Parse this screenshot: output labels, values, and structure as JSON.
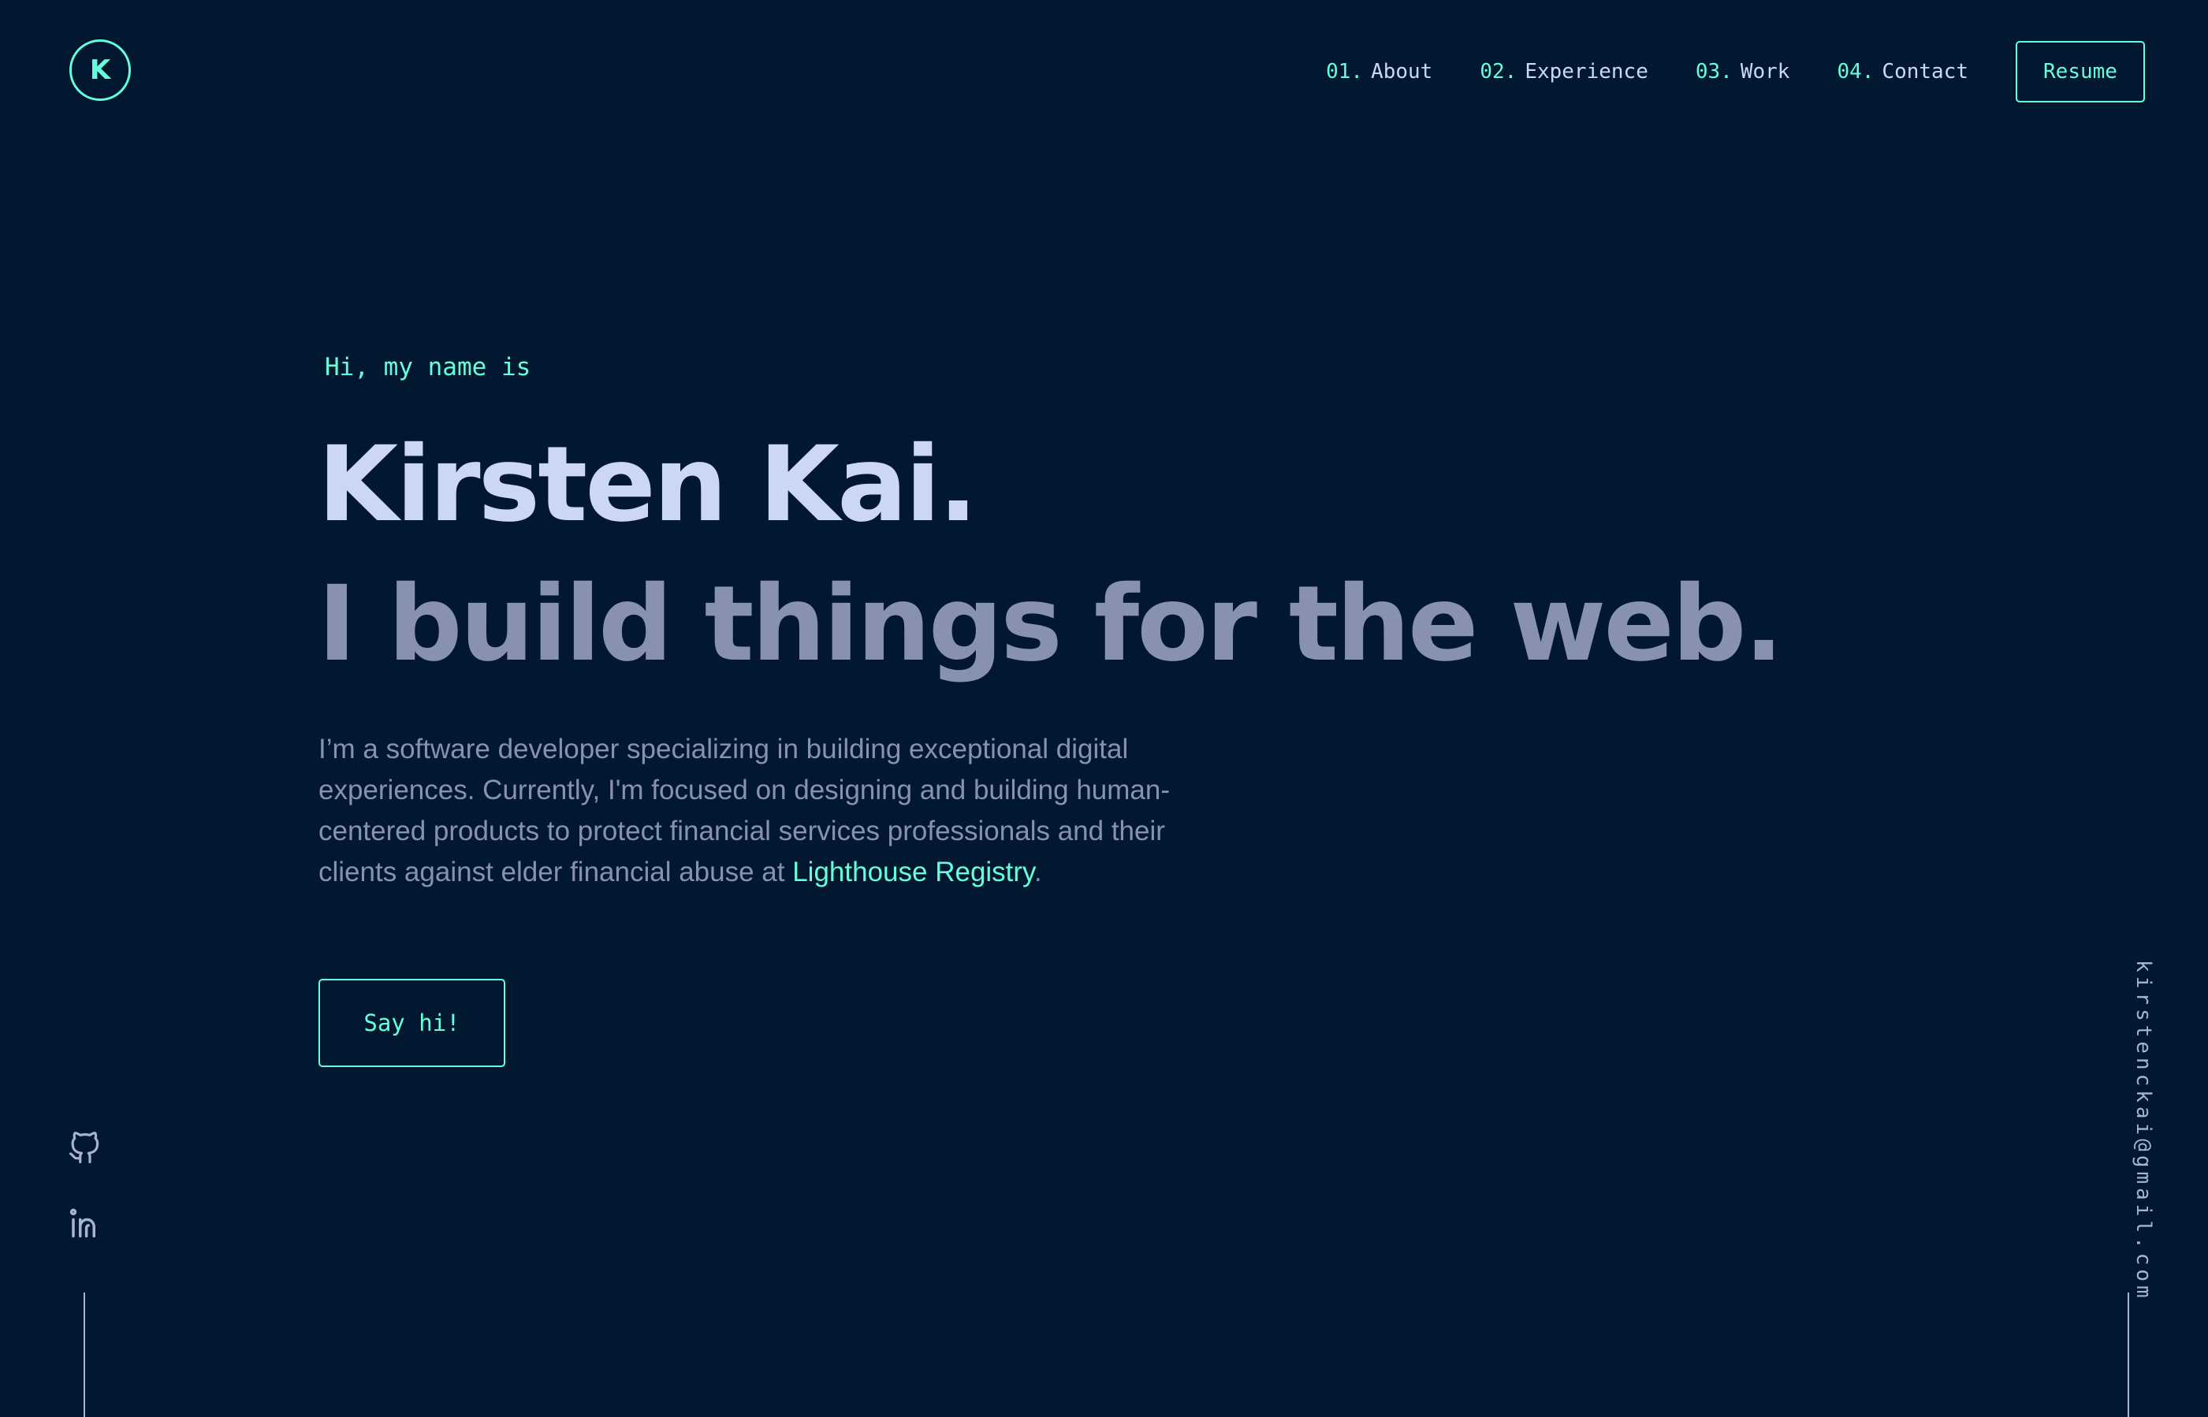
{
  "logo": {
    "letter": "K"
  },
  "nav": {
    "items": [
      {
        "num": "01.",
        "label": "About"
      },
      {
        "num": "02.",
        "label": "Experience"
      },
      {
        "num": "03.",
        "label": "Work"
      },
      {
        "num": "04.",
        "label": "Contact"
      }
    ],
    "resume_label": "Resume"
  },
  "hero": {
    "greeting": "Hi, my name is",
    "name": "Kirsten Kai.",
    "tagline": "I build things for the web.",
    "description_before": "I’m a software developer specializing in building exceptional digital experiences. Currently, I'm focused on designing and building human-centered products to protect financial services professionals and their clients against elder financial abuse at ",
    "description_link": "Lighthouse Registry",
    "description_after": ".",
    "cta_label": "Say hi!"
  },
  "social": {
    "github_icon": "github-icon",
    "linkedin_icon": "linkedin-icon"
  },
  "email": "kirstenckai@gmail.com",
  "colors": {
    "background": "#021730",
    "accent": "#64ffda",
    "heading": "#ccd6f6",
    "text": "#8892b0"
  }
}
